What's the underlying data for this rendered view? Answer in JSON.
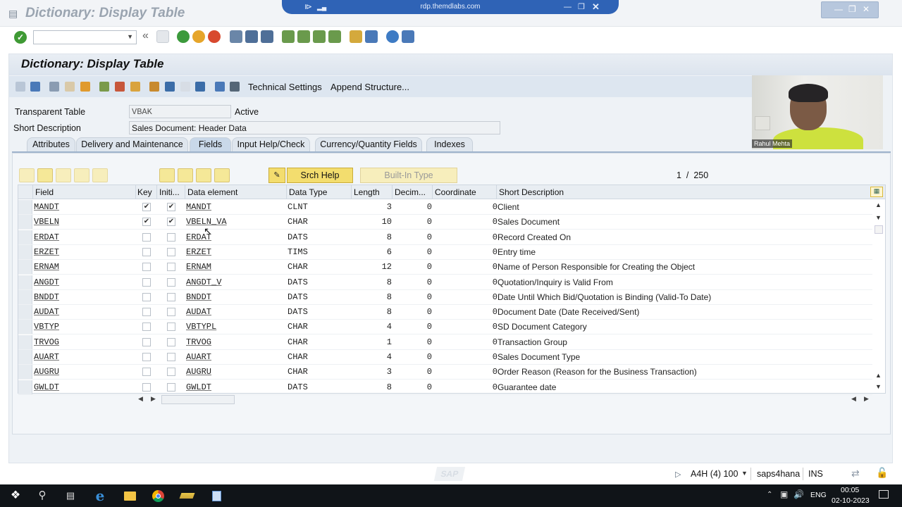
{
  "window": {
    "title": "Dictionary: Display Table"
  },
  "rdp": {
    "host": "rdp.themdlabs.com"
  },
  "panel": {
    "title": "Dictionary: Display Table"
  },
  "app_toolbar": {
    "technical_settings": "Technical Settings",
    "append_structure": "Append Structure..."
  },
  "header": {
    "transparent_table_label": "Transparent Table",
    "transparent_table_value": "VBAK",
    "status": "Active",
    "short_desc_label": "Short Description",
    "short_desc_value": "Sales Document: Header Data"
  },
  "tabs": [
    "Attributes",
    "Delivery and Maintenance",
    "Fields",
    "Input Help/Check",
    "Currency/Quantity Fields",
    "Indexes"
  ],
  "active_tab": "Fields",
  "field_toolbar": {
    "srch_help": "Srch Help",
    "built_in_type": "Built-In Type",
    "page_current": "1",
    "page_sep": "/",
    "page_total": "250"
  },
  "columns": [
    "Field",
    "Key",
    "Initi...",
    "Data element",
    "Data Type",
    "Length",
    "Decim...",
    "Coordinate",
    "Short Description"
  ],
  "rows": [
    {
      "field": "MANDT",
      "key": true,
      "init": true,
      "element": "MANDT",
      "type": "CLNT",
      "length": "3",
      "dec": "0",
      "coord": "0",
      "desc": "Client"
    },
    {
      "field": "VBELN",
      "key": true,
      "init": true,
      "element": "VBELN_VA",
      "type": "CHAR",
      "length": "10",
      "dec": "0",
      "coord": "0",
      "desc": "Sales Document"
    },
    {
      "field": "ERDAT",
      "key": false,
      "init": false,
      "element": "ERDAT",
      "type": "DATS",
      "length": "8",
      "dec": "0",
      "coord": "0",
      "desc": "Record Created On"
    },
    {
      "field": "ERZET",
      "key": false,
      "init": false,
      "element": "ERZET",
      "type": "TIMS",
      "length": "6",
      "dec": "0",
      "coord": "0",
      "desc": "Entry time"
    },
    {
      "field": "ERNAM",
      "key": false,
      "init": false,
      "element": "ERNAM",
      "type": "CHAR",
      "length": "12",
      "dec": "0",
      "coord": "0",
      "desc": "Name of Person Responsible for Creating the Object"
    },
    {
      "field": "ANGDT",
      "key": false,
      "init": false,
      "element": "ANGDT_V",
      "type": "DATS",
      "length": "8",
      "dec": "0",
      "coord": "0",
      "desc": "Quotation/Inquiry is Valid From"
    },
    {
      "field": "BNDDT",
      "key": false,
      "init": false,
      "element": "BNDDT",
      "type": "DATS",
      "length": "8",
      "dec": "0",
      "coord": "0",
      "desc": "Date Until Which Bid/Quotation is Binding (Valid-To Date)"
    },
    {
      "field": "AUDAT",
      "key": false,
      "init": false,
      "element": "AUDAT",
      "type": "DATS",
      "length": "8",
      "dec": "0",
      "coord": "0",
      "desc": "Document Date (Date Received/Sent)"
    },
    {
      "field": "VBTYP",
      "key": false,
      "init": false,
      "element": "VBTYPL",
      "type": "CHAR",
      "length": "4",
      "dec": "0",
      "coord": "0",
      "desc": "SD Document Category"
    },
    {
      "field": "TRVOG",
      "key": false,
      "init": false,
      "element": "TRVOG",
      "type": "CHAR",
      "length": "1",
      "dec": "0",
      "coord": "0",
      "desc": "Transaction Group"
    },
    {
      "field": "AUART",
      "key": false,
      "init": false,
      "element": "AUART",
      "type": "CHAR",
      "length": "4",
      "dec": "0",
      "coord": "0",
      "desc": "Sales Document Type"
    },
    {
      "field": "AUGRU",
      "key": false,
      "init": false,
      "element": "AUGRU",
      "type": "CHAR",
      "length": "3",
      "dec": "0",
      "coord": "0",
      "desc": "Order Reason (Reason for the Business Transaction)"
    },
    {
      "field": "GWLDT",
      "key": false,
      "init": false,
      "element": "GWLDT",
      "type": "DATS",
      "length": "8",
      "dec": "0",
      "coord": "0",
      "desc": "Guarantee date"
    }
  ],
  "video": {
    "name": "Rahul Mehta"
  },
  "status_bar": {
    "system": "A4H (4) 100",
    "server": "saps4hana",
    "mode": "INS"
  },
  "taskbar": {
    "lang": "ENG",
    "time": "00:05",
    "date": "02-10-2023"
  },
  "colors": {
    "accent": "#2f63b6",
    "button_yellow": "#f3dd6e",
    "ok_green": "#3f9a35",
    "taskbar": "#101418"
  },
  "icons": [
    "window-icon",
    "check-icon",
    "back-icon",
    "save-icon",
    "exit-icon",
    "cancel-icon",
    "print-icon",
    "find-icon",
    "help-icon",
    "layout-icon",
    "search-help-icon",
    "column-config-icon",
    "windows-icon",
    "search-icon",
    "edge-icon",
    "folder-icon",
    "chrome-icon"
  ]
}
